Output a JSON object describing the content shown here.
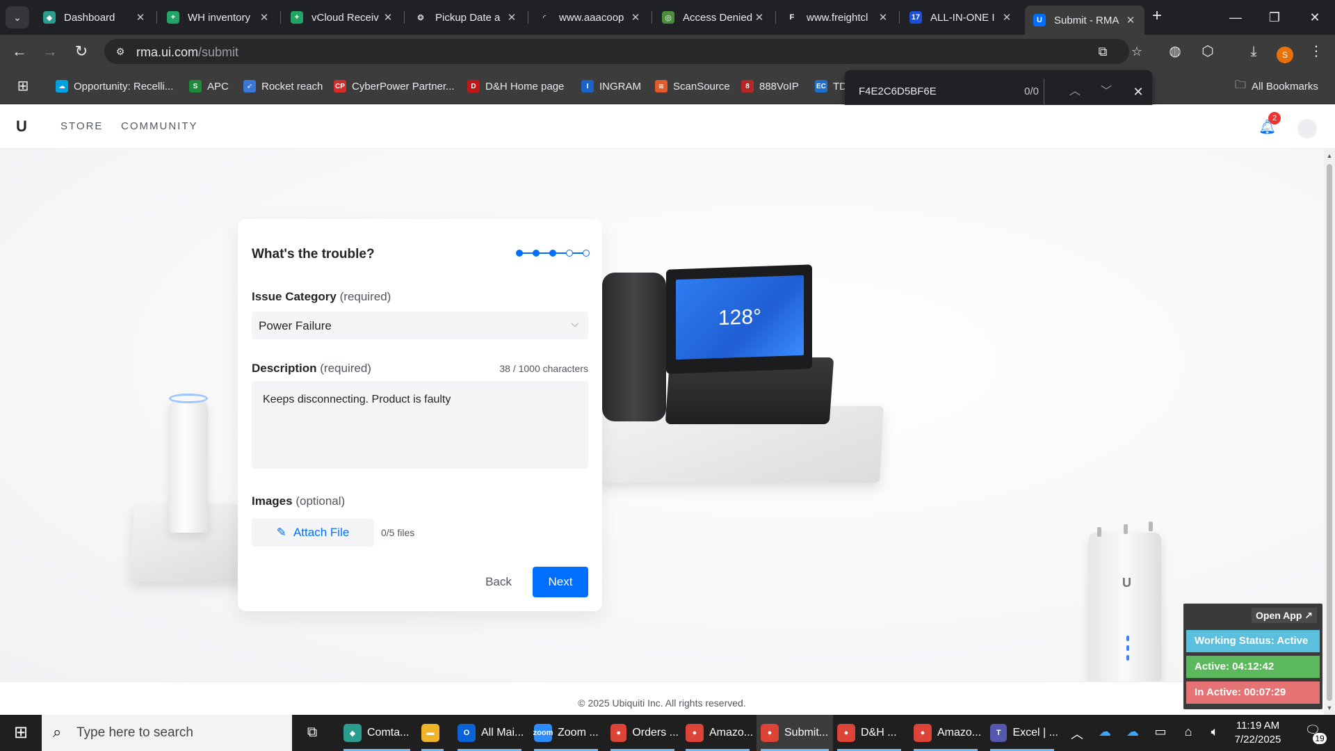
{
  "browser": {
    "tabs": [
      {
        "title": "Dashboard",
        "icon": "dashboard-icon",
        "color": "#2a9d8f",
        "glyph": "◆"
      },
      {
        "title": "WH inventory",
        "icon": "sheets-icon",
        "color": "#21a464",
        "glyph": "+"
      },
      {
        "title": "vCloud Receiv",
        "icon": "sheets-icon",
        "color": "#21a464",
        "glyph": "+"
      },
      {
        "title": "Pickup Date a",
        "icon": "openai-icon",
        "color": "#202124",
        "glyph": "❂"
      },
      {
        "title": "www.aaacoop",
        "icon": "loading-icon",
        "color": "#202124",
        "glyph": "◜"
      },
      {
        "title": "Access Denied",
        "icon": "globe-icon",
        "color": "#4a8f3c",
        "glyph": "◎"
      },
      {
        "title": "www.freightcl",
        "icon": "fcc-icon",
        "color": "#202124",
        "glyph": "F"
      },
      {
        "title": "ALL-IN-ONE I",
        "icon": "seventeen-icon",
        "color": "#1c4fd8",
        "glyph": "17"
      },
      {
        "title": "Submit - RMA",
        "icon": "ubiquiti-icon",
        "color": "#006fff",
        "glyph": "U"
      }
    ],
    "url_host": "rma.ui.com",
    "url_path": "/submit",
    "profile_initial": "S",
    "bookmarks": [
      {
        "label": "Opportunity: Recelli...",
        "color": "#00a1e0",
        "glyph": "☁"
      },
      {
        "label": "APC",
        "color": "#1e8a3c",
        "glyph": "S"
      },
      {
        "label": "Rocket reach",
        "color": "#3a78d8",
        "glyph": "➶"
      },
      {
        "label": "CyberPower Partner...",
        "color": "#d62b2b",
        "glyph": "CP"
      },
      {
        "label": "D&H Home page",
        "color": "#c01818",
        "glyph": "D"
      },
      {
        "label": "INGRAM",
        "color": "#1a63c6",
        "glyph": "I"
      },
      {
        "label": "ScanSource",
        "color": "#e05a2a",
        "glyph": "≋"
      },
      {
        "label": "888VoIP",
        "color": "#b52828",
        "glyph": "8"
      },
      {
        "label": "TD",
        "color": "#1e6fd0",
        "glyph": "EC"
      }
    ],
    "all_bookmarks": "All Bookmarks",
    "find": {
      "query": "F4E2C6D5BF6E",
      "count": "0/0"
    }
  },
  "site": {
    "nav": [
      "STORE",
      "COMMUNITY"
    ],
    "notifications": "2"
  },
  "form": {
    "title": "What's the trouble?",
    "steps_total": 5,
    "steps_done": 3,
    "category_label": "Issue Category",
    "category_req": "(required)",
    "category_value": "Power Failure",
    "description_label": "Description",
    "description_req": "(required)",
    "char_count": "38 / 1000 characters",
    "description_value": "Keeps disconnecting. Product is faulty",
    "images_label": "Images",
    "images_req": "(optional)",
    "attach_label": "Attach File",
    "file_count": "0/5 files",
    "back_label": "Back",
    "next_label": "Next"
  },
  "screen_text": "128°",
  "footer": {
    "copyright": "© 2025 Ubiquiti Inc. All rights reserved."
  },
  "status_widget": {
    "open_app": "Open App ↗",
    "working": "Working Status: Active",
    "active": "Active: 04:12:42",
    "inactive": "In Active: 00:07:29",
    "colors": {
      "working": "#5bc0de",
      "active": "#5cb85c",
      "inactive": "#e57373"
    }
  },
  "taskbar": {
    "search_placeholder": "Type here to search",
    "apps": [
      {
        "label": "Comta...",
        "color": "#2a9d8f",
        "glyph": "◆",
        "active": false
      },
      {
        "label": "",
        "color": "#f0b429",
        "glyph": "▬",
        "active": false
      },
      {
        "label": "All Mai...",
        "color": "#0a64d8",
        "glyph": "O",
        "active": false
      },
      {
        "label": "Zoom ...",
        "color": "#2d8cff",
        "glyph": "zoom",
        "active": false
      },
      {
        "label": "Orders ...",
        "color": "#db4437",
        "glyph": "●",
        "active": false
      },
      {
        "label": "Amazo...",
        "color": "#db4437",
        "glyph": "●",
        "active": false
      },
      {
        "label": "Submit...",
        "color": "#db4437",
        "glyph": "●",
        "active": true
      },
      {
        "label": "D&H ...",
        "color": "#db4437",
        "glyph": "●",
        "active": false
      },
      {
        "label": "Amazo...",
        "color": "#db4437",
        "glyph": "●",
        "active": false
      },
      {
        "label": "Excel | ...",
        "color": "#5558af",
        "glyph": "T",
        "active": false
      }
    ],
    "time": "11:19 AM",
    "date": "7/22/2025",
    "notif_count": "19"
  }
}
